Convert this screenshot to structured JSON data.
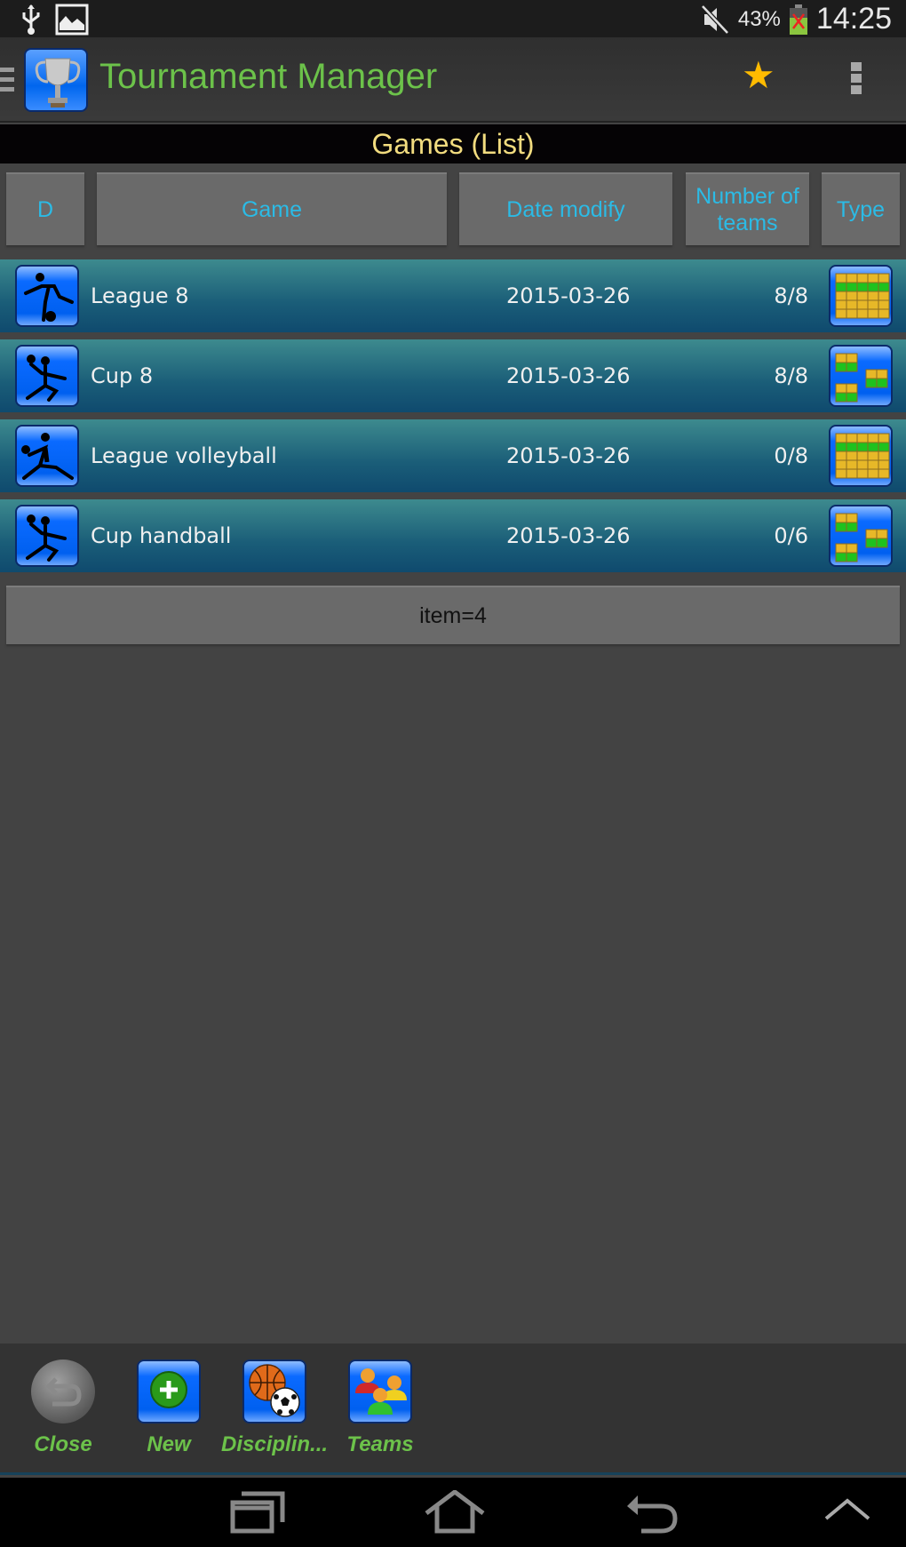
{
  "status_bar": {
    "left_icons": [
      "usb-icon",
      "image-icon"
    ],
    "right_icons": [
      "mute-icon",
      "battery-icon"
    ],
    "battery_percent": "43%",
    "time": "14:25"
  },
  "action_bar": {
    "title": "Tournament Manager",
    "app_icon": "trophy-icon",
    "actions": [
      "star-icon",
      "overflow-menu-icon"
    ],
    "accent_color": "#6cc24a"
  },
  "section": {
    "title": "Games (List)"
  },
  "table": {
    "columns": [
      "D",
      "Game",
      "Date modify",
      "Number of teams",
      "Type"
    ],
    "rows": [
      {
        "discipline_icon": "soccer-player-icon",
        "game": "League 8",
        "date": "2015-03-26",
        "teams": "8/8",
        "type_icon": "league-grid-icon"
      },
      {
        "discipline_icon": "handball-player-icon",
        "game": "Cup 8",
        "date": "2015-03-26",
        "teams": "8/8",
        "type_icon": "cup-bracket-icon"
      },
      {
        "discipline_icon": "volleyball-player-icon",
        "game": "League volleyball",
        "date": "2015-03-26",
        "teams": "0/8",
        "type_icon": "league-grid-icon"
      },
      {
        "discipline_icon": "handball-player-icon",
        "game": "Cup handball",
        "date": "2015-03-26",
        "teams": "0/6",
        "type_icon": "cup-bracket-icon"
      }
    ],
    "footer": "item=4"
  },
  "toolbar": {
    "buttons": [
      {
        "label": "Close",
        "icon": "close-back-icon"
      },
      {
        "label": "New",
        "icon": "add-icon"
      },
      {
        "label": "Disciplin...",
        "icon": "disciplines-balls-icon"
      },
      {
        "label": "Teams",
        "icon": "teams-people-icon"
      }
    ]
  },
  "nav_bar": {
    "buttons": [
      "recent-apps-icon",
      "home-icon",
      "back-icon",
      "up-chevron-icon"
    ]
  }
}
